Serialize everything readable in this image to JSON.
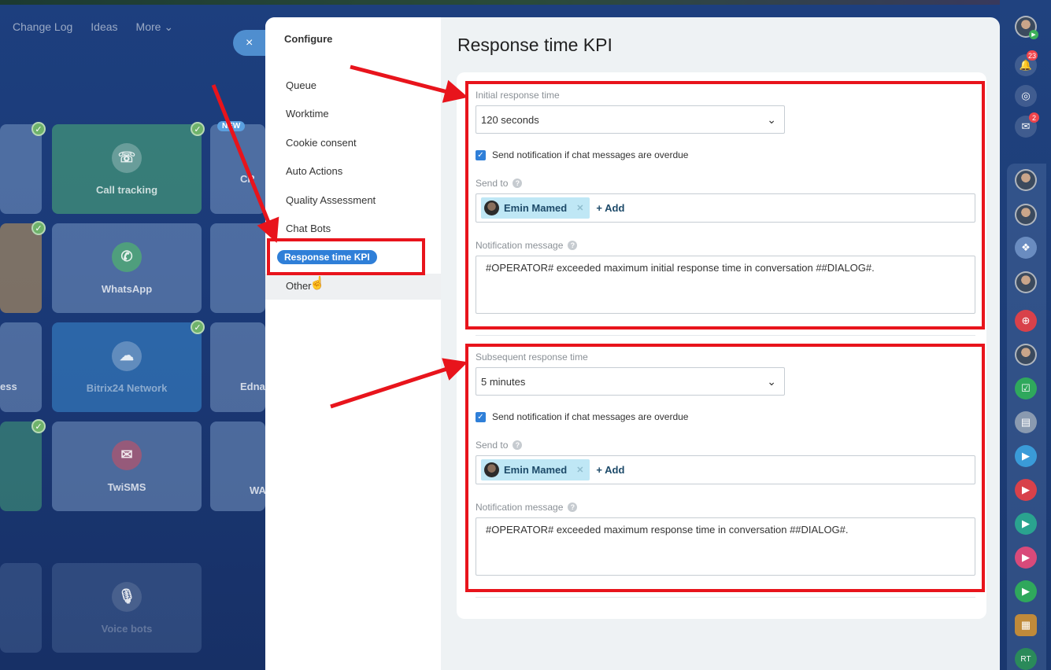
{
  "background": {
    "nav": [
      "Change Log",
      "Ideas",
      "More ⌄"
    ],
    "close_icon": "×",
    "new_badge": "NEW",
    "tiles": [
      {
        "label": "",
        "icon": ""
      },
      {
        "label": "Call tracking",
        "icon": "phone-refresh-icon"
      },
      {
        "label": "CR",
        "icon": ""
      },
      {
        "label": "",
        "icon": ""
      },
      {
        "label": "WhatsApp",
        "icon": "whatsapp-icon"
      },
      {
        "label": "",
        "icon": ""
      },
      {
        "label": "ess",
        "icon": ""
      },
      {
        "label": "Bitrix24 Network",
        "icon": "cloud-icon"
      },
      {
        "label": "Edna",
        "icon": ""
      },
      {
        "label": "",
        "icon": ""
      },
      {
        "label": "TwiSMS",
        "icon": "sms-icon"
      },
      {
        "label": "WA",
        "icon": ""
      },
      {
        "label": "Voice bots",
        "icon": "microphone-icon"
      }
    ]
  },
  "sidebar": {
    "title": "Configure",
    "items": [
      "Queue",
      "Worktime",
      "Cookie consent",
      "Auto Actions",
      "Quality Assessment",
      "Chat Bots",
      "Response time KPI",
      "Other"
    ],
    "active": "Response time KPI"
  },
  "content": {
    "title": "Response time KPI",
    "sections": [
      {
        "label": "Initial response time",
        "select_value": "120 seconds",
        "checkbox_label": "Send notification if chat messages are overdue",
        "checked": true,
        "send_to_label": "Send to",
        "recipient": "Emin Mamed",
        "add_label": "+ Add",
        "message_label": "Notification message",
        "message": "#OPERATOR# exceeded maximum initial response time in conversation ##DIALOG#."
      },
      {
        "label": "Subsequent response time",
        "select_value": "5 minutes",
        "checkbox_label": "Send notification if chat messages are overdue",
        "checked": true,
        "send_to_label": "Send to",
        "recipient": "Emin Mamed",
        "add_label": "+ Add",
        "message_label": "Notification message",
        "message": "#OPERATOR# exceeded maximum response time in conversation ##DIALOG#."
      }
    ]
  },
  "right_bar": {
    "notifications_count": "23",
    "chat_count": "2",
    "initials": "RT"
  },
  "colors": {
    "accent": "#2f7fd8",
    "highlight": "#e8141c",
    "chip": "#bfe7f5"
  }
}
